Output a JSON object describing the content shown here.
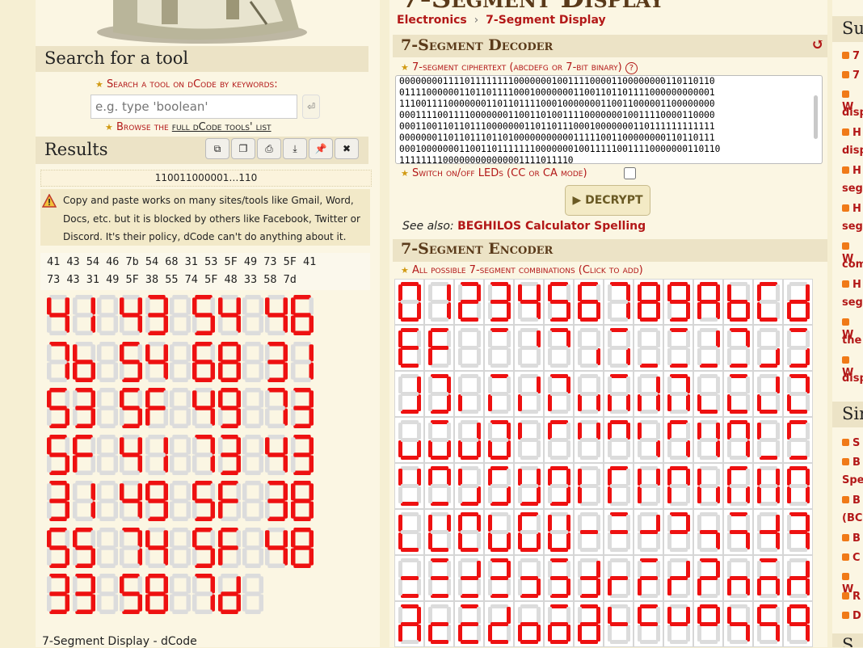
{
  "left": {
    "search_title": "Search for a tool",
    "search_label": "Search a tool on dCode by keywords:",
    "search_placeholder": "e.g. type 'boolean'",
    "enter_glyph": "⏎",
    "browse_prefix": "Browse the",
    "browse_link": "full dCode tools' list",
    "results_title": "Results",
    "result_value": "110011000001…110",
    "notice": "Copy and paste works on many sites/tools like Gmail, Word, Docs, etc. but it is blocked by others like Facebook, Twitter or Discord. It's their policy, dCode can't do anything about it.",
    "hex_line1": "41 43 54 46 7b 54 68 31 53 5F 49 73 5F 41",
    "hex_line2": "73 43 31 49 5F 38 55 74 5F 48 33 58 7d",
    "result_pairs": [
      "41",
      "43",
      "54",
      "46",
      "7b",
      "54",
      "68",
      "31",
      "53",
      "5F",
      "49",
      "73",
      "5F",
      "41",
      "73",
      "43",
      "31",
      "49",
      "5F",
      "38",
      "55",
      "74",
      "5F",
      "48",
      "33",
      "58",
      "7d"
    ],
    "footer_title": "7-Segment Display - dCode",
    "toolbar_icons": [
      "copy-icon",
      "copy-variant-icon",
      "print-icon",
      "download-icon",
      "pin-icon",
      "close-icon"
    ]
  },
  "middle": {
    "page_title": "7-Segment Display",
    "breadcrumb": [
      "Electronics",
      "›",
      "7-Segment Display"
    ],
    "decoder_title": "7-Segment Decoder",
    "refresh_glyph": "↺",
    "ciphertext_label": "7-segment ciphertext (abcdefg or 7-bit binary)",
    "help_glyph": "?",
    "ciphertext_value": "0000000011110111111110000000100111100001100000000110110110\n0111100000011011011110001000000011001101101111000000000001\n1110011110000000110110111100010000000110011000001100000000\n0001111001111000000011001101001111000000010011110000110000\n0001100110110111000000011011011100010000000110111111111111\n0000000110110111011010000000000011111001100000000110110111\n00010000000110011011111110000000100111110011110000000110110\n11111111000000000000001111011110",
    "switch_label": "Switch on/off LEDs (CC or CA mode)",
    "decrypt_label": "▶ DECRYPT",
    "see_also_prefix": "See also:",
    "see_also_link": "BEGHILOS Calculator Spelling",
    "encoder_title": "7-Segment Encoder",
    "combinations_label": "All possible 7-segment combinations (Click to add)"
  },
  "right": {
    "sidebar_title_top": "Su",
    "sidebar_title_mid": "Sin",
    "sidebar_title_bottom": "S",
    "items_top": [
      "7",
      "7",
      "W",
      "disp",
      "H",
      "disp",
      "H",
      "seg",
      "H",
      "seg",
      "W",
      "com",
      "H",
      "seg",
      "W",
      "the",
      "W",
      "disp"
    ],
    "items_mid": [
      "S",
      "B",
      "Spe",
      "B",
      "(BC",
      "B",
      "C",
      "W",
      "R",
      "D"
    ]
  },
  "colors": {
    "accent": "#b31818",
    "segment_on": "#ee1111",
    "segment_off": "#dcdcdc",
    "panel": "#ece3c6"
  }
}
